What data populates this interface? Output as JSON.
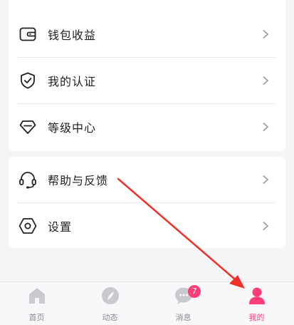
{
  "menu_group_1": {
    "items": [
      {
        "label": "钱包收益",
        "icon": "wallet-icon"
      },
      {
        "label": "我的认证",
        "icon": "shield-check-icon"
      },
      {
        "label": "等级中心",
        "icon": "diamond-icon"
      }
    ]
  },
  "menu_group_2": {
    "items": [
      {
        "label": "帮助与反馈",
        "icon": "headset-icon"
      },
      {
        "label": "设置",
        "icon": "settings-hexagon-icon"
      }
    ]
  },
  "tabbar": {
    "tabs": [
      {
        "label": "首页",
        "icon": "home-icon",
        "active": false
      },
      {
        "label": "动态",
        "icon": "compass-feather-icon",
        "active": false
      },
      {
        "label": "消息",
        "icon": "chat-bubble-icon",
        "active": false,
        "badge": "7"
      },
      {
        "label": "我的",
        "icon": "person-icon",
        "active": true
      }
    ]
  },
  "colors": {
    "accent": "#ff3d77",
    "icon_inactive": "#c9c9cf",
    "annotation_arrow": "#f0312a"
  }
}
